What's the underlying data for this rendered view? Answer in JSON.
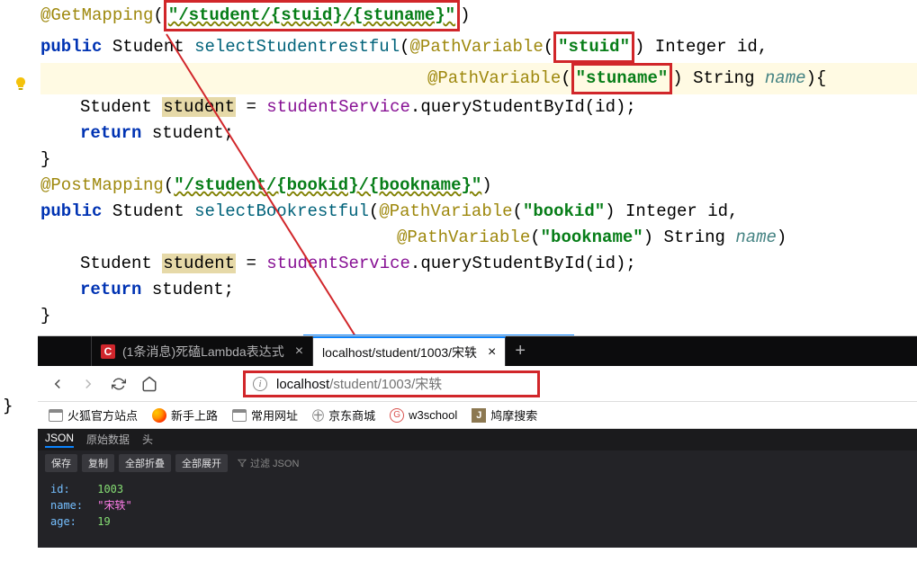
{
  "code": {
    "ann_get": "@GetMapping",
    "get_url": "\"/student/{stuid}/{stuname}\"",
    "kw_public": "public",
    "t_student": "Student",
    "m_select1": "selectStudentrestful",
    "ann_pv": "@PathVariable",
    "pv_stuid": "\"stuid\"",
    "t_integer": "Integer",
    "p_id": "id",
    "pv_stuname": "\"stuname\"",
    "t_string": "String",
    "p_name": "name",
    "var_student": "student",
    "svc": "studentService",
    "m_query": "queryStudentById",
    "kw_return": "return",
    "ann_post": "@PostMapping",
    "post_url": "\"/student/{bookid}/{bookname}\"",
    "m_select2": "selectBookrestful",
    "pv_bookid": "\"bookid\"",
    "pv_bookname": "\"bookname\""
  },
  "browser": {
    "tab1": "(1条消息)死磕Lambda表达式",
    "tab2": "localhost/student/1003/宋轶",
    "url_host": "localhost",
    "url_path": "/student/1003/宋轶",
    "bookmarks": {
      "b1": "火狐官方站点",
      "b2": "新手上路",
      "b3": "常用网址",
      "b4": "京东商城",
      "b5": "w3school",
      "b6": "鸠摩搜索"
    },
    "dev": {
      "json": "JSON",
      "raw": "原始数据",
      "head": "头",
      "save": "保存",
      "copy": "复制",
      "collapse": "全部折叠",
      "expand": "全部展开",
      "filter": "过滤 JSON"
    },
    "json_response": {
      "id_key": "id:",
      "id_val": "1003",
      "name_key": "name:",
      "name_val": "\"宋轶\"",
      "age_key": "age:",
      "age_val": "19"
    }
  }
}
